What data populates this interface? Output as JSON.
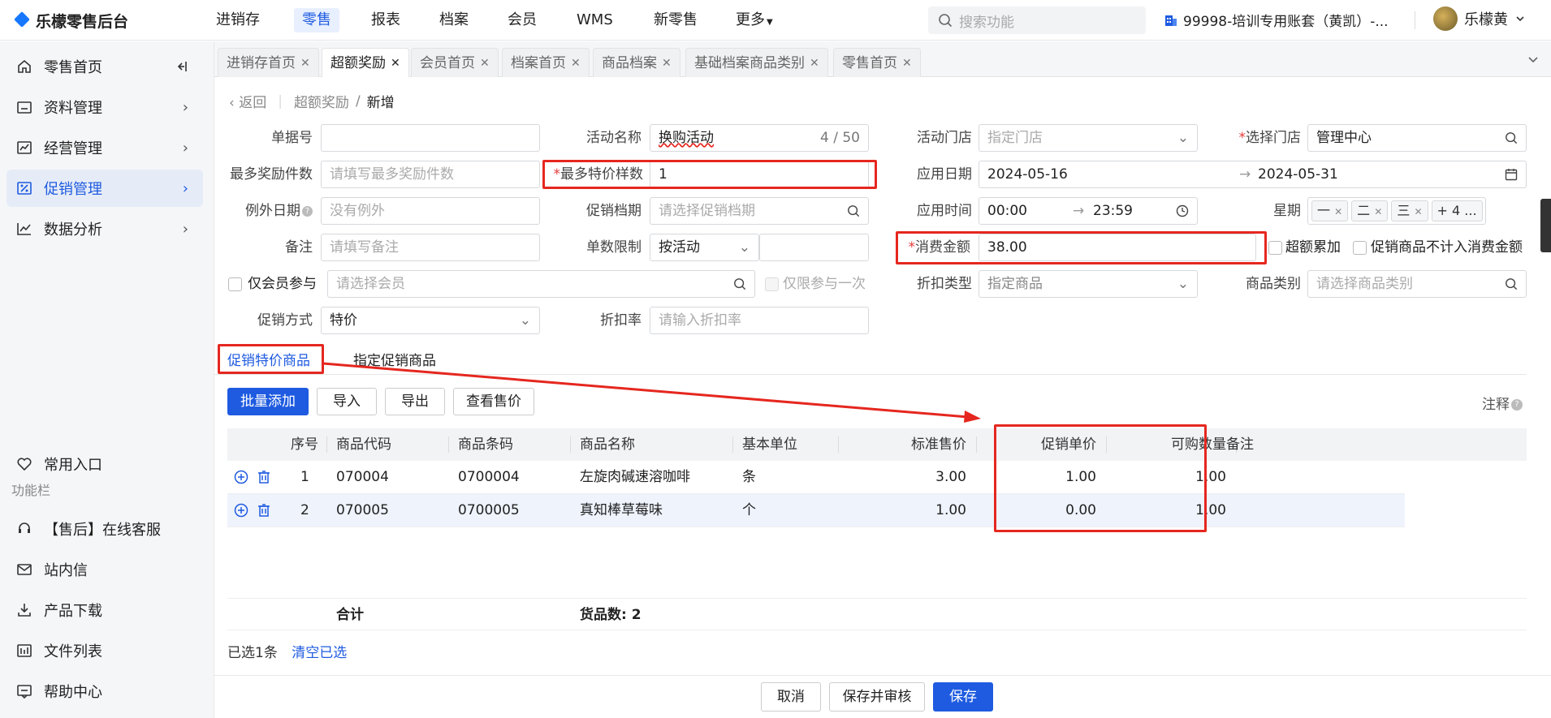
{
  "app": {
    "title": "乐檬零售后台"
  },
  "nav": {
    "items": [
      "进销存",
      "零售",
      "报表",
      "档案",
      "会员",
      "WMS",
      "新零售",
      "更多"
    ],
    "active": "零售",
    "search_placeholder": "搜索功能",
    "account": "99998-培训专用账套（黄凯）-...",
    "user": "乐檬黄"
  },
  "sidebar": {
    "items": [
      {
        "label": "零售首页",
        "icon": "home-icon"
      },
      {
        "label": "资料管理",
        "icon": "folder-icon"
      },
      {
        "label": "经营管理",
        "icon": "chart-icon"
      },
      {
        "label": "促销管理",
        "icon": "promo-icon"
      },
      {
        "label": "数据分析",
        "icon": "analysis-icon"
      }
    ],
    "active": "促销管理",
    "common_entry": "常用入口",
    "section_label": "功能栏",
    "tools": [
      "【售后】在线客服",
      "站内信",
      "产品下载",
      "文件列表",
      "帮助中心"
    ]
  },
  "tabs": [
    {
      "label": "进销存首页"
    },
    {
      "label": "超额奖励",
      "active": true
    },
    {
      "label": "会员首页"
    },
    {
      "label": "档案首页"
    },
    {
      "label": "商品档案"
    },
    {
      "label": "基础档案商品类别"
    },
    {
      "label": "零售首页"
    }
  ],
  "breadcrumb": {
    "back": "返回",
    "parent": "超额奖励",
    "current": "新增"
  },
  "form": {
    "doc_no": {
      "label": "单据号",
      "value": ""
    },
    "activity_name": {
      "label": "活动名称",
      "value": "换购活动",
      "counter": "4 / 50"
    },
    "activity_store": {
      "label": "活动门店",
      "placeholder": "指定门店"
    },
    "select_store": {
      "label": "选择门店",
      "value": "管理中心"
    },
    "max_reward_qty": {
      "label": "最多奖励件数",
      "placeholder": "请填写最多奖励件数"
    },
    "max_special_count": {
      "label": "最多特价样数",
      "value": "1"
    },
    "apply_date": {
      "label": "应用日期",
      "start": "2024-05-16",
      "end": "2024-05-31"
    },
    "exception_date": {
      "label": "例外日期",
      "placeholder": "没有例外"
    },
    "promo_period": {
      "label": "促销档期",
      "placeholder": "请选择促销档期"
    },
    "apply_time": {
      "label": "应用时间",
      "start": "00:00",
      "end": "23:59"
    },
    "weekday": {
      "label": "星期",
      "tags": [
        "一",
        "二",
        "三"
      ],
      "more": "+ 4 ..."
    },
    "remark": {
      "label": "备注",
      "placeholder": "请填写备注"
    },
    "order_limit": {
      "label": "单数限制",
      "value": "按活动"
    },
    "consume_amount": {
      "label": "消费金额",
      "value": "38.00"
    },
    "over_accumulate": {
      "label": "超额累加"
    },
    "exclude_promo": {
      "label": "促销商品不计入消费金额"
    },
    "member_only": {
      "label": "仅会员参与",
      "placeholder": "请选择会员"
    },
    "once_only": {
      "label": "仅限参与一次"
    },
    "discount_type": {
      "label": "折扣类型",
      "value": "指定商品"
    },
    "category": {
      "label": "商品类别",
      "placeholder": "请选择商品类别"
    },
    "promo_method": {
      "label": "促销方式",
      "value": "特价"
    },
    "discount_rate": {
      "label": "折扣率",
      "placeholder": "请输入折扣率"
    }
  },
  "subtabs": {
    "active": "促销特价商品",
    "other": "指定促销商品"
  },
  "toolbar": {
    "batch_add": "批量添加",
    "import": "导入",
    "export": "导出",
    "view_price": "查看售价",
    "notes": "注释"
  },
  "table": {
    "columns": [
      "序号",
      "商品代码",
      "商品条码",
      "商品名称",
      "基本单位",
      "标准售价",
      "促销单价",
      "可购数量",
      "备注"
    ],
    "rows": [
      {
        "seq": "1",
        "code": "070004",
        "barcode": "0700004",
        "name": "左旋肉碱速溶咖啡",
        "unit": "条",
        "std_price": "3.00",
        "promo_price": "1.00",
        "qty": "1.00",
        "note": ""
      },
      {
        "seq": "2",
        "code": "070005",
        "barcode": "0700005",
        "name": "真知棒草莓味",
        "unit": "个",
        "std_price": "1.00",
        "promo_price": "0.00",
        "qty": "1.00",
        "note": ""
      }
    ],
    "summary": {
      "label": "合计",
      "count": "货品数: 2"
    }
  },
  "selection": {
    "selected": "已选1条",
    "clear": "清空已选"
  },
  "footer": {
    "cancel": "取消",
    "save_audit": "保存并审核",
    "save": "保存"
  },
  "colors": {
    "accent": "#1f5be0",
    "highlight": "#e5271f"
  }
}
